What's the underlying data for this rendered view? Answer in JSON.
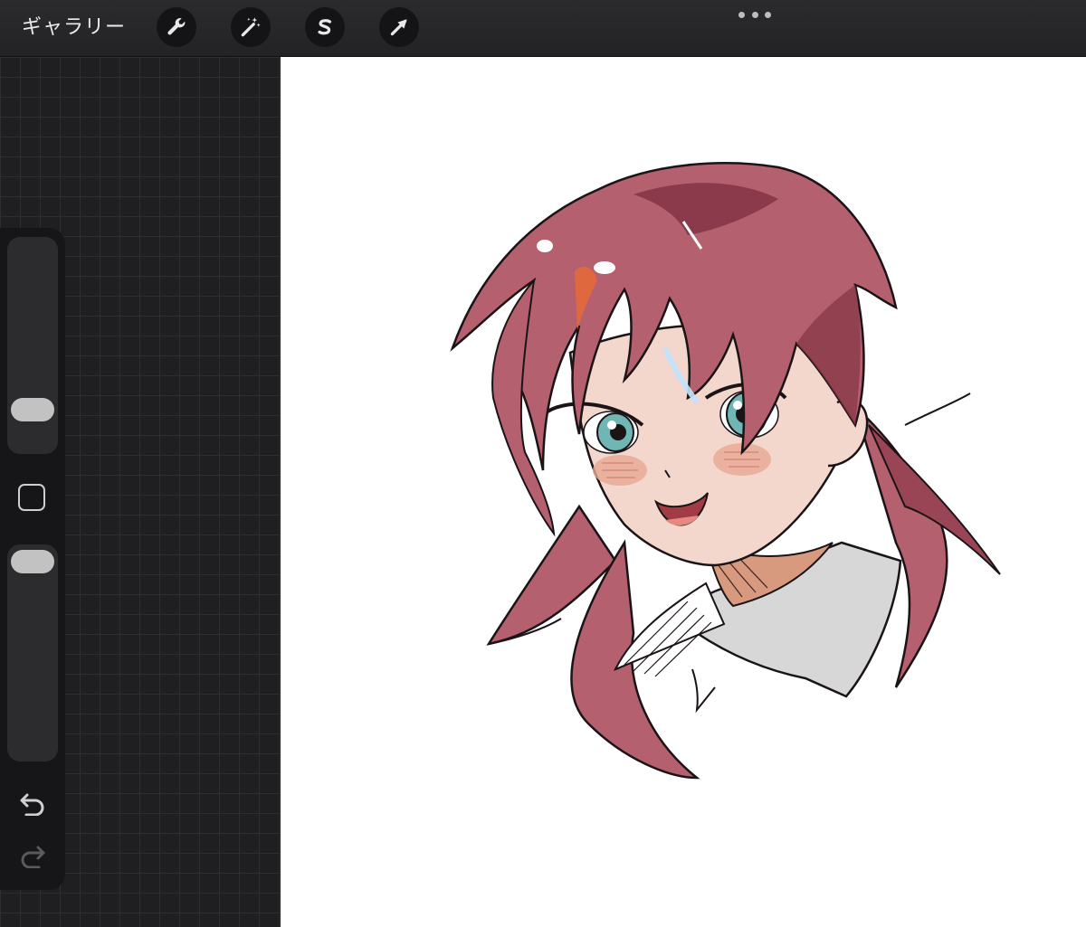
{
  "toolbar": {
    "gallery_label": "ギャラリー",
    "tools": [
      {
        "name": "actions",
        "icon": "wrench-icon"
      },
      {
        "name": "adjustments",
        "icon": "magic-wand-icon"
      },
      {
        "name": "selection",
        "icon": "s-selection-icon"
      },
      {
        "name": "transform",
        "icon": "arrow-cursor-icon"
      }
    ],
    "more_icon": "ellipsis-icon"
  },
  "sidebar": {
    "brush_size_icon": "slider-thumb",
    "modify_icon": "square-icon",
    "opacity_icon": "slider-thumb",
    "undo_icon": "undo-icon",
    "redo_icon": "redo-icon"
  },
  "canvas": {
    "content": "artwork",
    "colors": {
      "hair": "#b5606e",
      "hair_shadow": "#8a3a4a",
      "skin": "#f3d6cc",
      "eyes": "#6fb6b4",
      "collar": "#d7d7d7",
      "line": "#1a1416"
    }
  },
  "colors": {
    "toolbar_bg": "#2b2b2d",
    "grid_bg": "#1f1f21",
    "sidebar_bg": "#161618",
    "canvas_bg": "#ffffff"
  }
}
